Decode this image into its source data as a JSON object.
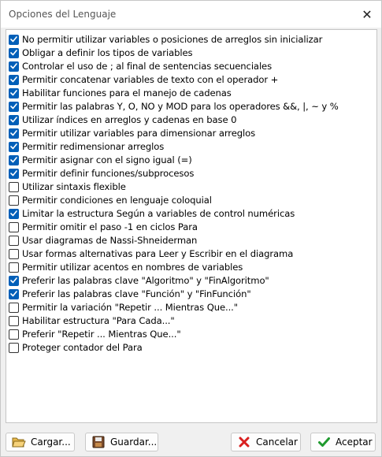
{
  "window": {
    "title": "Opciones del Lenguaje",
    "close_glyph": "✕"
  },
  "options": [
    {
      "label": "No permitir utilizar variables o posiciones de arreglos sin inicializar",
      "checked": true
    },
    {
      "label": "Obligar a definir los tipos de variables",
      "checked": true
    },
    {
      "label": "Controlar el uso de ; al final de sentencias secuenciales",
      "checked": true
    },
    {
      "label": "Permitir concatenar variables de texto con el operador +",
      "checked": true
    },
    {
      "label": "Habilitar funciones para el manejo de cadenas",
      "checked": true
    },
    {
      "label": "Permitir las palabras Y, O, NO y MOD para los operadores &&, |, ~ y %",
      "checked": true
    },
    {
      "label": "Utilizar índices en arreglos y cadenas en base 0",
      "checked": true
    },
    {
      "label": "Permitir utilizar variables para dimensionar arreglos",
      "checked": true
    },
    {
      "label": "Permitir redimensionar arreglos",
      "checked": true
    },
    {
      "label": "Permitir asignar con el signo igual (=)",
      "checked": true
    },
    {
      "label": "Permitir definir funciones/subprocesos",
      "checked": true
    },
    {
      "label": "Utilizar sintaxis flexible",
      "checked": false
    },
    {
      "label": "Permitir condiciones en lenguaje coloquial",
      "checked": false
    },
    {
      "label": "Limitar la estructura Según a variables de control numéricas",
      "checked": true
    },
    {
      "label": "Permitir omitir el paso -1 en ciclos Para",
      "checked": false
    },
    {
      "label": "Usar diagramas de Nassi-Shneiderman",
      "checked": false
    },
    {
      "label": "Usar formas alternativas para Leer y Escribir en el diagrama",
      "checked": false
    },
    {
      "label": "Permitir utilizar acentos en nombres de variables",
      "checked": false
    },
    {
      "label": "Preferir las palabras clave \"Algoritmo\" y \"FinAlgoritmo\"",
      "checked": true
    },
    {
      "label": "Preferir las palabras clave \"Función\" y \"FinFunción\"",
      "checked": true
    },
    {
      "label": "Permitir la variación \"Repetir ... Mientras Que...\"",
      "checked": false
    },
    {
      "label": "Habilitar estructura \"Para Cada...\"",
      "checked": false
    },
    {
      "label": "Preferir \"Repetir ... Mientras Que...\"",
      "checked": false
    },
    {
      "label": "Proteger contador del Para",
      "checked": false
    }
  ],
  "buttons": {
    "load": {
      "label": "Cargar...",
      "icon": "folder-open-icon"
    },
    "save": {
      "label": "Guardar...",
      "icon": "floppy-disk-icon"
    },
    "cancel": {
      "label": "Cancelar",
      "icon": "red-x-icon"
    },
    "accept": {
      "label": "Aceptar",
      "icon": "green-check-icon"
    }
  },
  "colors": {
    "checkbox_checked": "#005fb8",
    "cancel_icon": "#d92020",
    "accept_icon": "#1f9a2e"
  }
}
